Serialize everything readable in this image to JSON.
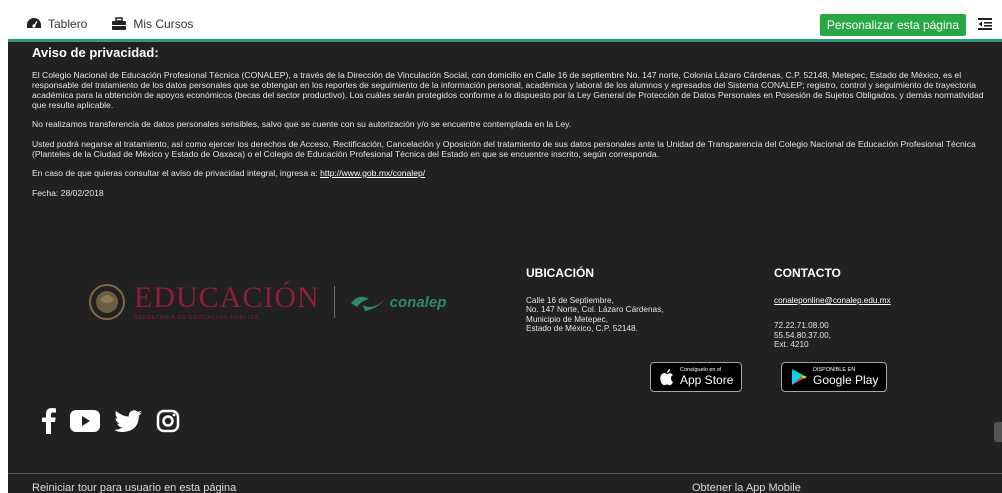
{
  "topbar": {
    "nav": [
      {
        "label": "Tablero",
        "icon": "dashboard-icon"
      },
      {
        "label": "Mis Cursos",
        "icon": "briefcase-icon"
      }
    ],
    "customize_label": "Personalizar esta página",
    "accent": "#28a745"
  },
  "privacy": {
    "title": "Aviso de privacidad:",
    "paragraphs": [
      "El Colegio Nacional de Educación Profesional Técnica (CONALEP), a través de la Dirección de Vinculación Social, con domicilio en Calle 16 de septiembre No. 147 norte, Colonia Lázaro Cárdenas, C.P. 52148, Metepec, Estado de México, es el responsable del tratamiento de los datos personales que se obtengan en los reportes de seguimiento de la información personal, académica y laboral de los alumnos y egresados del Sistema CONALEP; registro, control y seguimiento de trayectoria académica para la obtención de apoyos económicos (becas del sector productivo). Los cuáles serán protegidos conforme a lo dispuesto por la Ley General de Protección de Datos Personales en Posesión de Sujetos Obligados, y demás normatividad que resulte aplicable.",
      "No realizamos transferencia de datos personales sensibles, salvo que se cuente con su autorización y/o se encuentre contemplada en la Ley.",
      "Usted podrá negarse al tratamiento, así como ejercer los derechos de Acceso, Rectificación, Cancelación y Oposición del tratamiento de sus datos personales ante la Unidad de Transparencia del Colegio Nacional de Educación Profesional Técnica (Planteles de la Ciudad de México y Estado de Oaxaca) o el Colegio de Educación Profesional Técnica del Estado en que se encuentre inscrito, según corresponda."
    ],
    "consult_text": "En caso de que quieras consultar el aviso de privacidad integral, ingresa a: ",
    "consult_link": "http://www.gob.mx/conalep/",
    "date": "Fecha: 28/02/2018"
  },
  "logos": {
    "sep_title": "EDUCACIÓN",
    "sep_subtitle": "SECRETARÍA DE EDUCACIÓN PÚBLICA",
    "conalep": "conalep"
  },
  "location": {
    "title": "UBICACIÓN",
    "lines": [
      "Calle 16 de Septiembre,",
      "No. 147 Norte, Col. Lázaro Cárdenas,",
      "Municipio de Metepec,",
      "Estado de México, C.P. 52148."
    ]
  },
  "contact": {
    "title": "CONTACTO",
    "email": "conaleponline@conalep.edu.mx",
    "phones": [
      "72.22.71.08.00",
      "55.54.80.37.00,",
      "Ext. 4210"
    ]
  },
  "stores": {
    "apple_top": "Consíguelo en el",
    "apple_main": "App Store",
    "google_top": "DISPONIBLE EN",
    "google_main": "Google Play"
  },
  "social": [
    "facebook-icon",
    "youtube-icon",
    "twitter-icon",
    "instagram-icon"
  ],
  "bottom": {
    "tour": "Reiniciar tour para usuario en esta página",
    "mobile": "Obtener la App Mobile"
  }
}
